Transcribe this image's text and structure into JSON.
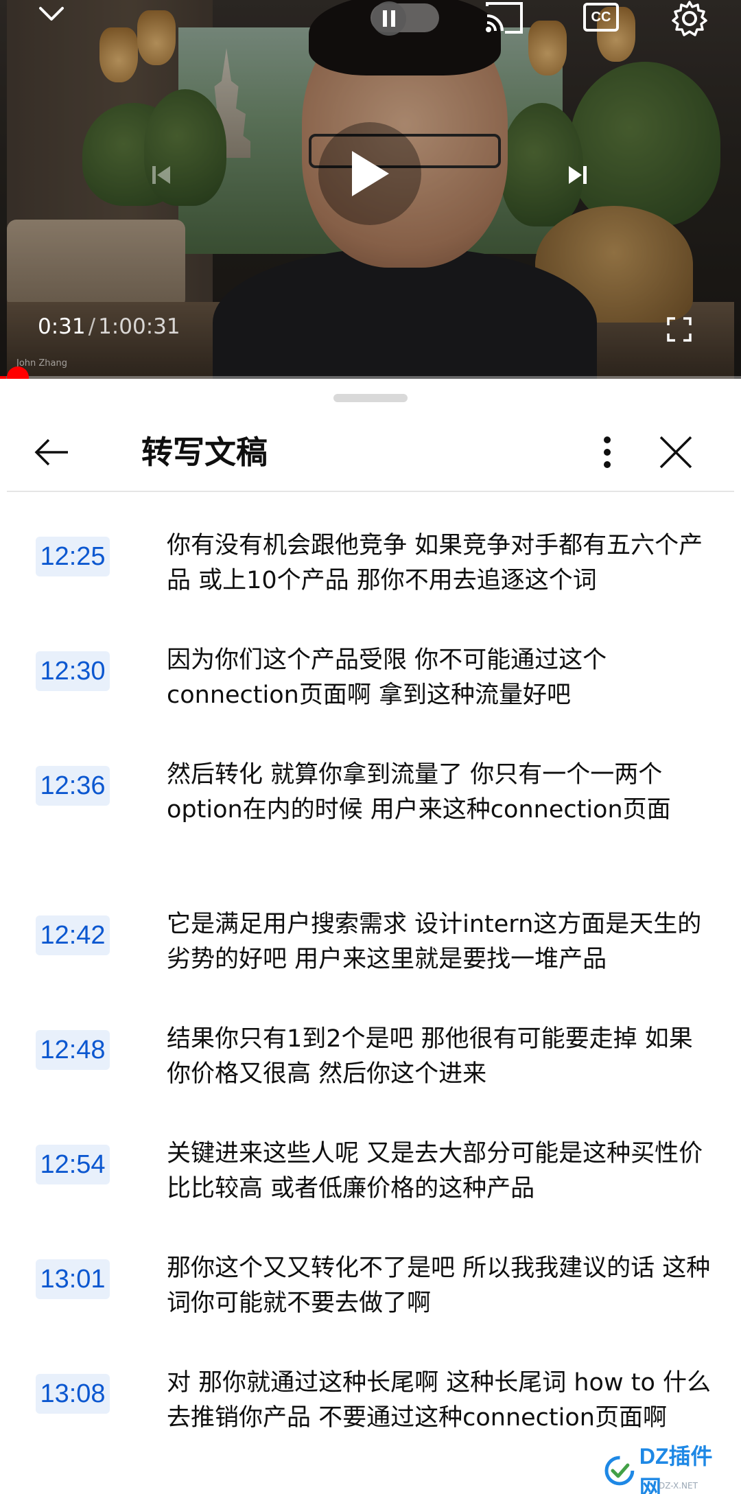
{
  "player": {
    "current_time": "0:31",
    "separator": "/",
    "duration": "1:00:31",
    "speaker_label": "John Zhang",
    "cc_label": "CC",
    "progress_fraction": 0.0086,
    "accent_color": "#ff0000"
  },
  "panel": {
    "title": "转写文稿"
  },
  "segments": [
    {
      "time": "12:25",
      "text": "你有没有机会跟他竞争 如果竞争对手都有五六个产品 或上10个产品 那你不用去追逐这个词"
    },
    {
      "time": "12:30",
      "text": "因为你们这个产品受限 你不可能通过这个connection页面啊 拿到这种流量好吧"
    },
    {
      "time": "12:36",
      "text": "然后转化 就算你拿到流量了 你只有一个一两个option在内的时候 用户来这种connection页面"
    },
    {
      "time": "12:42",
      "text": "它是满足用户搜索需求 设计intern这方面是天生的劣势的好吧 用户来这里就是要找一堆产品"
    },
    {
      "time": "12:48",
      "text": "结果你只有1到2个是吧 那他很有可能要走掉 如果你价格又很高 然后你这个进来"
    },
    {
      "time": "12:54",
      "text": "关键进来这些人呢 又是去大部分可能是这种买性价比比较高 或者低廉价格的这种产品"
    },
    {
      "time": "13:01",
      "text": "那你这个又又转化不了是吧 所以我我建议的话 这种词你可能就不要去做了啊"
    },
    {
      "time": "13:08",
      "text": "对 那你就通过这种长尾啊 这种长尾词 how to 什么 去推销你产品 不要通过这种connection页面啊"
    }
  ],
  "watermark": {
    "brand": "DZ插件网",
    "sub": "DZ-X.NET"
  },
  "colors": {
    "timestamp_bg": "#e8f0fb",
    "timestamp_text": "#0b57d0"
  }
}
